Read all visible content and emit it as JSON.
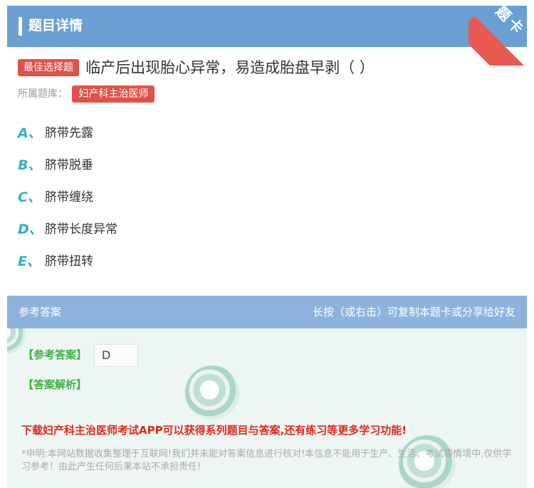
{
  "header": {
    "title": "题目详情"
  },
  "ribbon": {
    "text": "题卡"
  },
  "question": {
    "type_badge": "最佳选择题",
    "text": "临产后出现胎心异常，易造成胎盘早剥（ ）"
  },
  "bank": {
    "label": "所属题库：",
    "name": "妇产科主治医师"
  },
  "options": [
    {
      "letter": "A、",
      "text": "脐带先露"
    },
    {
      "letter": "B、",
      "text": "脐带脱垂"
    },
    {
      "letter": "C、",
      "text": "脐带缠绕"
    },
    {
      "letter": "D、",
      "text": "脐带长度异常"
    },
    {
      "letter": "E、",
      "text": "脐带扭转"
    }
  ],
  "answer_section": {
    "title": "参考答案",
    "hint": "长按（或右击）可复制本题卡或分享给好友",
    "answer_label": "【参考答案】",
    "answer_value": "D",
    "analysis_label": "【答案解析】",
    "promo": "下载妇产科主治医师考试APP可以获得系列题目与答案,还有练习等更多学习功能!",
    "disclaimer": "*申明:本网站数据收集整理于互联网!我们并未能对答案信息进行核对!本信息不能用于生产、生活、考试等情境中,仅供学习参考！由此产生任何后果本站不承担责任!"
  },
  "colors": {
    "header": "#6a9fd4",
    "badge": "#e0514a",
    "option_letter": "#2fb5b8",
    "answer_green": "#3fb044",
    "promo_red": "#e0271d"
  }
}
